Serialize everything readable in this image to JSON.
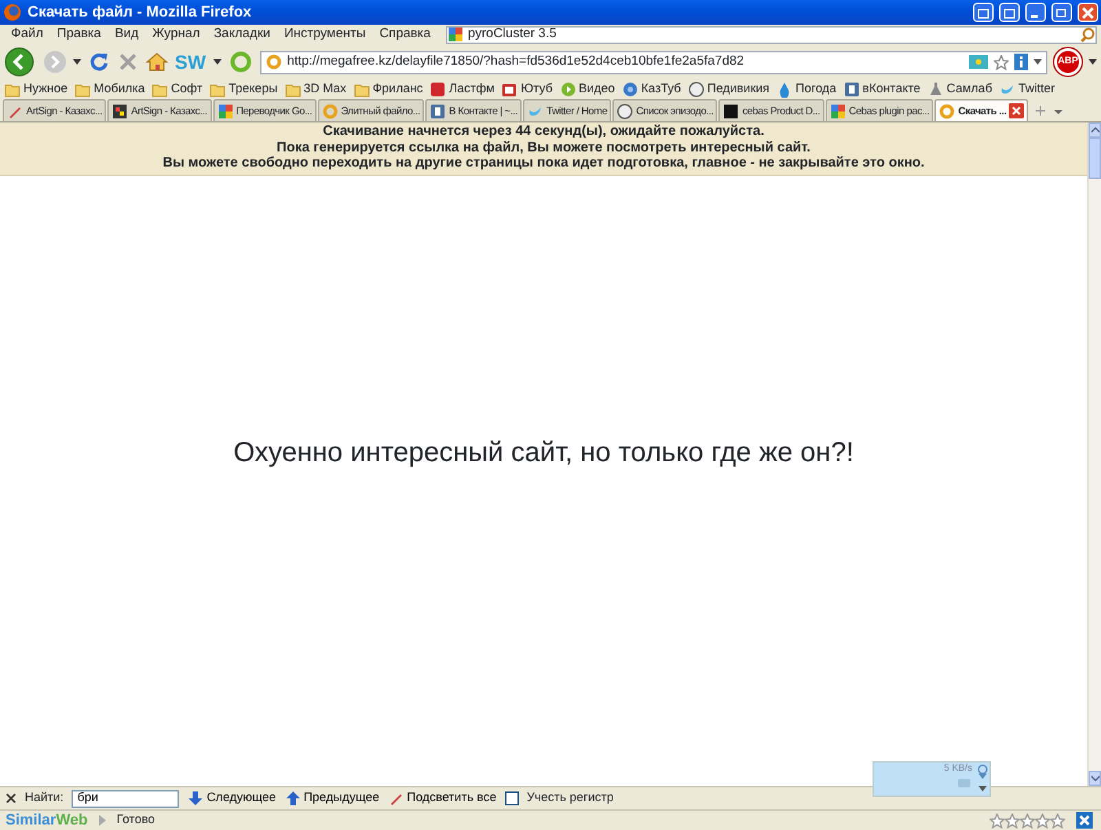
{
  "window": {
    "title": "Скачать файл - Mozilla Firefox"
  },
  "menu": [
    "Файл",
    "Правка",
    "Вид",
    "Журнал",
    "Закладки",
    "Инструменты",
    "Справка"
  ],
  "search_bar": {
    "engine": "pyroCluster 3.5"
  },
  "nav": {
    "addon_label": "SW",
    "url": "http://megafree.kz/delayfile71850/?hash=fd536d1e52d4ceb10bfe1fe2a5fa7d82",
    "adblock_label": "ABP"
  },
  "bookmarks": [
    {
      "label": "Нужное",
      "kind": "folder"
    },
    {
      "label": "Мобилка",
      "kind": "folder"
    },
    {
      "label": "Софт",
      "kind": "folder"
    },
    {
      "label": "Трекеры",
      "kind": "folder"
    },
    {
      "label": "3D Max",
      "kind": "folder"
    },
    {
      "label": "Фриланс",
      "kind": "folder"
    },
    {
      "label": "Ластфм",
      "kind": "square"
    },
    {
      "label": "Ютуб",
      "kind": "tv"
    },
    {
      "label": "Видео",
      "kind": "play"
    },
    {
      "label": "КазТуб",
      "kind": "globe"
    },
    {
      "label": "Педивикия",
      "kind": "wiki"
    },
    {
      "label": "Погода",
      "kind": "drop"
    },
    {
      "label": "вКонтакте",
      "kind": "vk"
    },
    {
      "label": "Самлаб",
      "kind": "lab"
    },
    {
      "label": "Twitter",
      "kind": "bird"
    }
  ],
  "tabs": [
    {
      "label": "ArtSign - Казахс...",
      "kind": "pen",
      "selected": false
    },
    {
      "label": "ArtSign - Казахс...",
      "kind": "blocks",
      "selected": false
    },
    {
      "label": "Переводчик Go...",
      "kind": "google",
      "selected": false
    },
    {
      "label": "Элитный файло...",
      "kind": "ring",
      "selected": false
    },
    {
      "label": "В Контакте | ~...",
      "kind": "vk",
      "selected": false
    },
    {
      "label": "Twitter / Home",
      "kind": "bird",
      "selected": false
    },
    {
      "label": "Список эпизодо...",
      "kind": "wiki",
      "selected": false
    },
    {
      "label": "cebas Product D...",
      "kind": "dark",
      "selected": false
    },
    {
      "label": "Cebas plugin pac...",
      "kind": "google",
      "selected": false
    },
    {
      "label": "Скачать ...",
      "kind": "ring",
      "selected": true
    }
  ],
  "banner": [
    "Скачивание начнется через 44 секунд(ы), ожидайте пожалуйста.",
    "Пока генерируется ссылка на файл, Вы можете посмотреть интересный сайт.",
    "Вы можете свободно переходить на другие страницы пока идет подготовка, главное - не закрывайте это окно."
  ],
  "headline": "Охуенно интересный сайт, но только где же он?!",
  "speed_widget": {
    "reading": "5 KB/s"
  },
  "find_bar": {
    "label": "Найти:",
    "value": "бри",
    "buttons": [
      {
        "label": "Следующее",
        "kind": "down"
      },
      {
        "label": "Предыдущее",
        "kind": "up"
      },
      {
        "label": "Подсветить все",
        "kind": "pen"
      }
    ],
    "match_case": {
      "label": "Учесть регистр",
      "checked": false
    }
  },
  "status_bar": {
    "logo_parts": [
      "Similar",
      "Web"
    ],
    "text": "Готово",
    "stars": 0
  }
}
